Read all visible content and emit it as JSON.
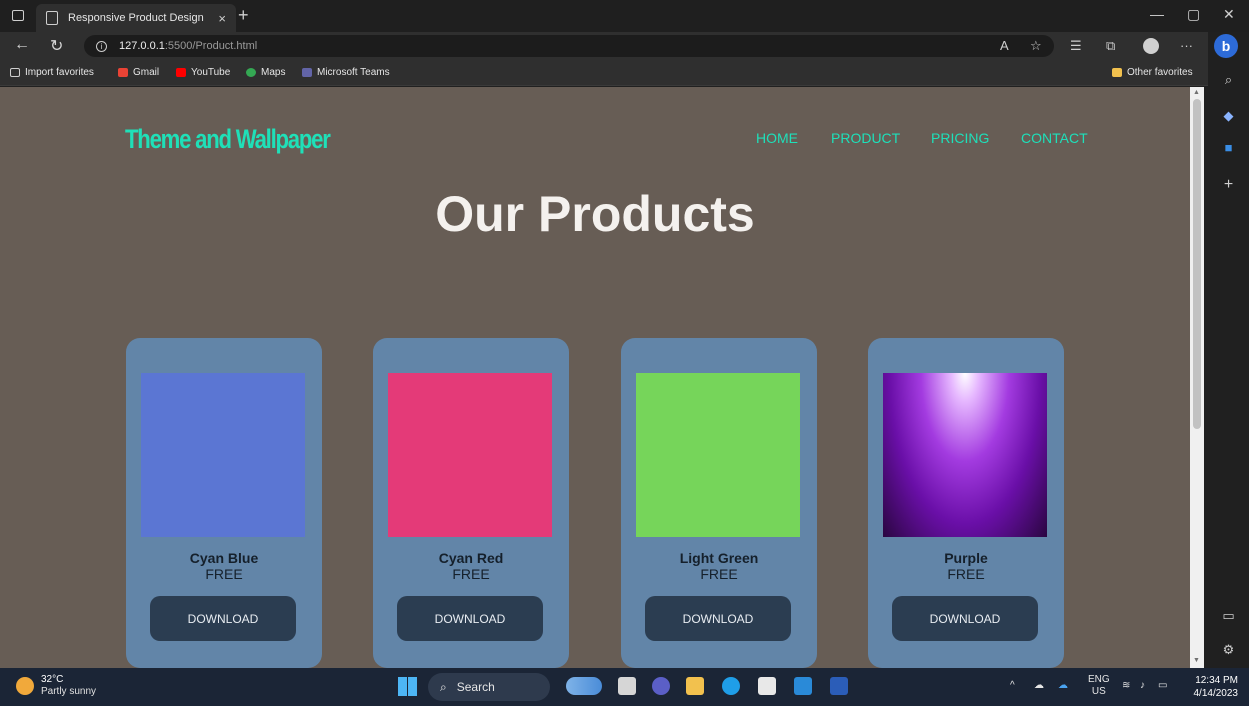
{
  "browser": {
    "tab_title": "Responsive Product Design",
    "tab_close": "×",
    "new_tab": "+",
    "url_host": "127.0.0.1",
    "url_rest": ":5500/Product.html",
    "url_info": "i",
    "minimize": "—",
    "restore": "▢",
    "close": "✕",
    "more": "···",
    "bing": "b"
  },
  "favorites": [
    {
      "label": "Import favorites",
      "color": "#cfcfcf"
    },
    {
      "label": "Gmail",
      "color": "#ea4335"
    },
    {
      "label": "YouTube",
      "color": "#ff0000"
    },
    {
      "label": "Maps",
      "color": "#34a853"
    },
    {
      "label": "Microsoft Teams",
      "color": "#6264a7"
    }
  ],
  "other_favorites": "Other favorites",
  "page": {
    "logo": "Theme and Wallpaper",
    "nav": [
      "HOME",
      "PRODUCT",
      "PRICING",
      "CONTACT"
    ],
    "heading": "Our Products",
    "accent_color": "#1ee0ba",
    "products": [
      {
        "name": "Cyan Blue",
        "price": "FREE",
        "button": "DOWNLOAD",
        "color": "#5b76d3"
      },
      {
        "name": "Cyan Red",
        "price": "FREE",
        "button": "DOWNLOAD",
        "color": "#e43a78"
      },
      {
        "name": "Light Green",
        "price": "FREE",
        "button": "DOWNLOAD",
        "color": "#76d55a"
      },
      {
        "name": "Purple",
        "price": "FREE",
        "button": "DOWNLOAD",
        "color": "#7a1bb0"
      }
    ]
  },
  "taskbar": {
    "temperature": "32°C",
    "weather": "Partly sunny",
    "search": "Search",
    "language": "ENG",
    "region": "US",
    "time": "12:34 PM",
    "date": "4/14/2023"
  }
}
